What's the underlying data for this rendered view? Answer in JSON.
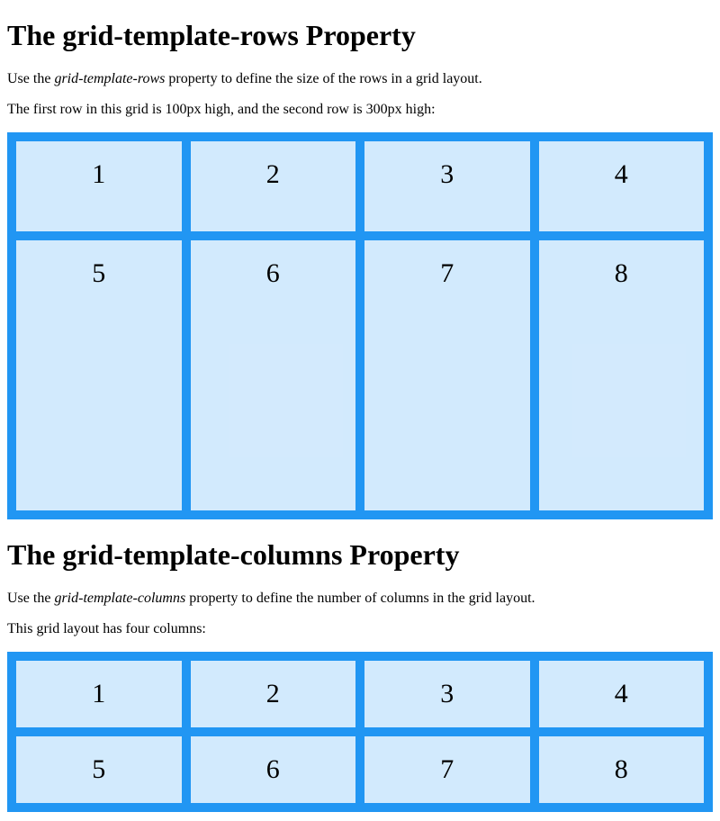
{
  "section1": {
    "heading": "The grid-template-rows Property",
    "p1_pre": "Use the ",
    "p1_em": "grid-template-rows",
    "p1_post": " property to define the size of the rows in a grid layout.",
    "p2": "The first row in this grid is 100px high, and the second row is 300px high:",
    "cells": [
      "1",
      "2",
      "3",
      "4",
      "5",
      "6",
      "7",
      "8"
    ]
  },
  "section2": {
    "heading": "The grid-template-columns Property",
    "p1_pre": "Use the ",
    "p1_em": "grid-template-columns",
    "p1_post": " property to define the number of columns in the grid layout.",
    "p2": "This grid layout has four columns:",
    "cells": [
      "1",
      "2",
      "3",
      "4",
      "5",
      "6",
      "7",
      "8"
    ]
  }
}
